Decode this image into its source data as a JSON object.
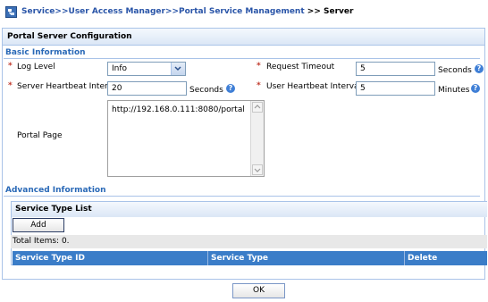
{
  "breadcrumb": {
    "items": [
      "Service",
      "User Access Manager",
      "Portal Service Management"
    ],
    "current": "Server",
    "separator": ">>",
    "last_separator": " >> "
  },
  "panel": {
    "title": "Portal Server Configuration"
  },
  "basic": {
    "heading": "Basic Information",
    "log_level": {
      "label": "Log Level",
      "value": "Info"
    },
    "request_timeout": {
      "label": "Request Timeout",
      "value": "5",
      "unit": "Seconds"
    },
    "server_heartbeat": {
      "label": "Server Heartbeat Interval",
      "value": "20",
      "unit": "Seconds"
    },
    "user_heartbeat": {
      "label": "User Heartbeat Interval",
      "value": "5",
      "unit": "Minutes"
    },
    "portal_page": {
      "label": "Portal Page",
      "value": "http://192.168.0.111:8080/portal"
    }
  },
  "advanced": {
    "heading": "Advanced Information",
    "list_title": "Service Type List",
    "add_label": "Add",
    "total_items": "Total Items: 0.",
    "columns": [
      "Service Type ID",
      "Service Type",
      "Delete"
    ]
  },
  "footer": {
    "ok_label": "OK"
  },
  "required_mark": "*",
  "help_mark": "?",
  "colors": {
    "link": "#2a55a8",
    "section": "#2a69b7",
    "header_bg": "#3b7dc8",
    "required": "#c0392b"
  }
}
